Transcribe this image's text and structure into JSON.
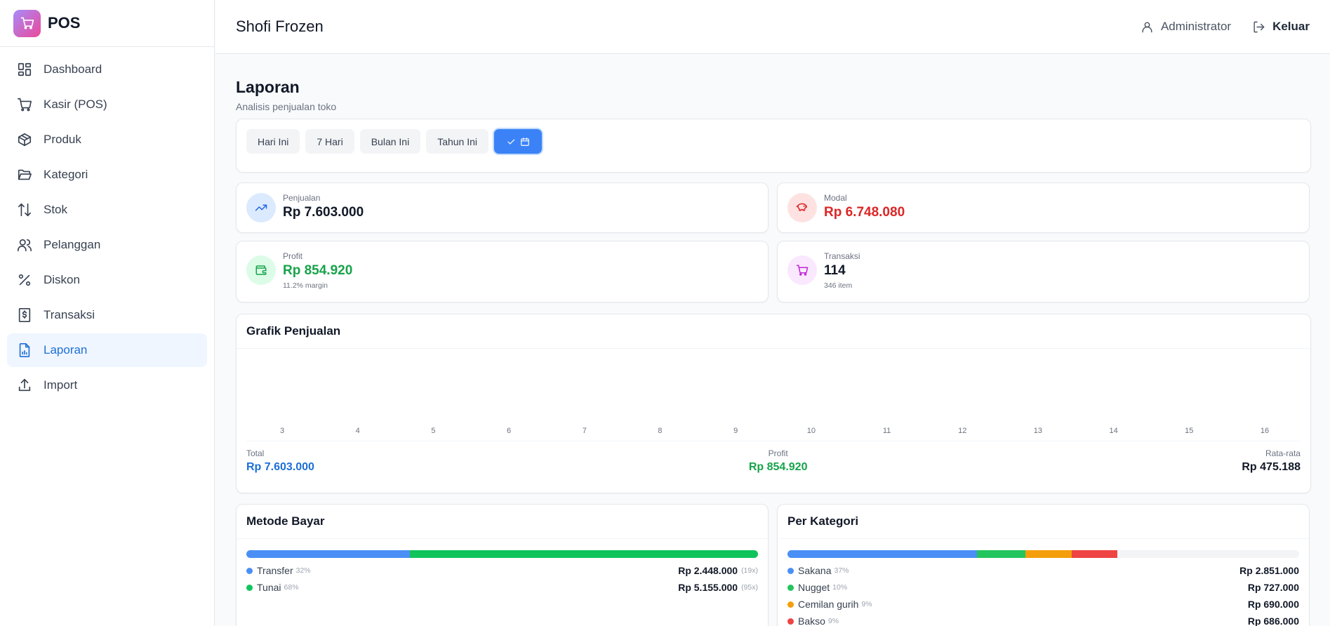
{
  "brand": {
    "name": "POS"
  },
  "sidebar": {
    "items": [
      {
        "label": "Dashboard",
        "icon": "dashboard-icon"
      },
      {
        "label": "Kasir (POS)",
        "icon": "cart-icon"
      },
      {
        "label": "Produk",
        "icon": "box-icon"
      },
      {
        "label": "Kategori",
        "icon": "folder-icon"
      },
      {
        "label": "Stok",
        "icon": "arrows-updown-icon"
      },
      {
        "label": "Pelanggan",
        "icon": "users-icon"
      },
      {
        "label": "Diskon",
        "icon": "percent-icon"
      },
      {
        "label": "Transaksi",
        "icon": "receipt-icon"
      },
      {
        "label": "Laporan",
        "icon": "report-icon",
        "active": true
      },
      {
        "label": "Import",
        "icon": "upload-icon"
      }
    ]
  },
  "header": {
    "store_name": "Shofi Frozen",
    "user_label": "Administrator",
    "logout_label": "Keluar"
  },
  "page": {
    "title": "Laporan",
    "subtitle": "Analisis penjualan toko"
  },
  "filters": {
    "today": "Hari Ini",
    "week": "7 Hari",
    "month": "Bulan Ini",
    "year": "Tahun Ini",
    "active": "custom-range"
  },
  "stats": {
    "sales": {
      "label": "Penjualan",
      "value": "Rp 7.603.000"
    },
    "cost": {
      "label": "Modal",
      "value": "Rp 6.748.080"
    },
    "profit": {
      "label": "Profit",
      "value": "Rp 854.920",
      "sub": "11.2% margin"
    },
    "transactions": {
      "label": "Transaksi",
      "value": "114",
      "sub": "346 item"
    }
  },
  "chart": {
    "title": "Grafik Penjualan",
    "summary": {
      "total_label": "Total",
      "total_value": "Rp 7.603.000",
      "profit_label": "Profit",
      "profit_value": "Rp 854.920",
      "avg_label": "Rata-rata",
      "avg_value": "Rp 475.188"
    }
  },
  "chart_data": {
    "type": "bar",
    "categories": [
      "3",
      "4",
      "5",
      "6",
      "7",
      "8",
      "9",
      "10",
      "11",
      "12",
      "13",
      "14",
      "15",
      "16"
    ],
    "values": []
  },
  "payment_methods": {
    "title": "Metode Bayar",
    "items": [
      {
        "name": "Transfer",
        "pct": "32%",
        "share": 0.32,
        "amount": "Rp 2.448.000",
        "count": "(19x)",
        "color": "#4a8ff5"
      },
      {
        "name": "Tunai",
        "pct": "68%",
        "share": 0.68,
        "amount": "Rp 5.155.000",
        "count": "(95x)",
        "color": "#10c45c"
      }
    ]
  },
  "categories": {
    "title": "Per Kategori",
    "items": [
      {
        "name": "Sakana",
        "pct": "37%",
        "share": 0.37,
        "amount": "Rp 2.851.000",
        "color": "#4a8ff5"
      },
      {
        "name": "Nugget",
        "pct": "10%",
        "share": 0.095,
        "amount": "Rp 727.000",
        "color": "#22c55e"
      },
      {
        "name": "Cemilan gurih",
        "pct": "9%",
        "share": 0.09,
        "amount": "Rp 690.000",
        "color": "#f59e0b"
      },
      {
        "name": "Bakso",
        "pct": "9%",
        "share": 0.09,
        "amount": "Rp 686.000",
        "color": "#ef4444"
      }
    ]
  }
}
